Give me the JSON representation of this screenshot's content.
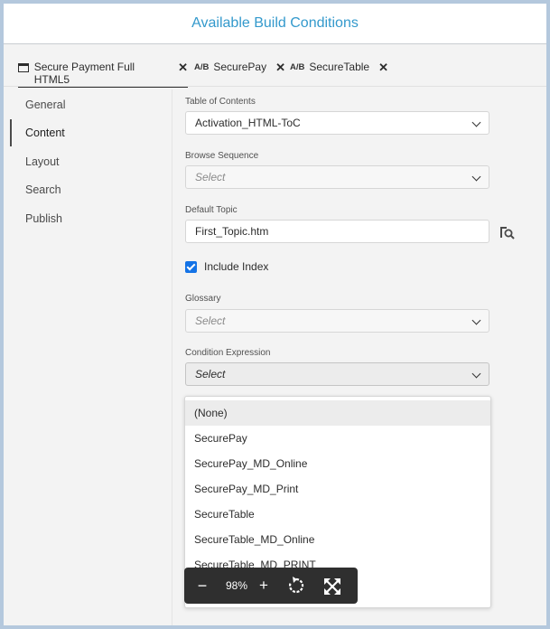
{
  "banner": {
    "title": "Available Build Conditions"
  },
  "tabs": [
    {
      "label": "Secure Payment Full HTML5",
      "prefix": "",
      "close": "✕"
    },
    {
      "label": "SecurePay",
      "prefix": "A/B",
      "close": "✕"
    },
    {
      "label": "SecureTable",
      "prefix": "A/B",
      "close": "✕"
    }
  ],
  "sidebar": {
    "items": [
      {
        "label": "General"
      },
      {
        "label": "Content"
      },
      {
        "label": "Layout"
      },
      {
        "label": "Search"
      },
      {
        "label": "Publish"
      }
    ],
    "active": "Content"
  },
  "form": {
    "toc": {
      "label": "Table of Contents",
      "value": "Activation_HTML-ToC"
    },
    "browse": {
      "label": "Browse Sequence",
      "placeholder": "Select"
    },
    "default_topic": {
      "label": "Default Topic",
      "value": "First_Topic.htm"
    },
    "include_index": {
      "label": "Include Index",
      "checked": true
    },
    "glossary": {
      "label": "Glossary",
      "placeholder": "Select"
    },
    "condition": {
      "label": "Condition Expression",
      "placeholder": "Select"
    }
  },
  "dropdown": {
    "options": [
      "(None)",
      "SecurePay",
      "SecurePay_MD_Online",
      "SecurePay_MD_Print",
      "SecureTable",
      "SecureTable_MD_Online",
      "SecureTable_MD_PRINT"
    ],
    "highlighted": "(None)"
  },
  "zoom": {
    "minus": "−",
    "level": "98%",
    "plus": "+"
  },
  "colors": {
    "accent": "#1473e6",
    "banner_text": "#3399cc",
    "frame": "#b4c8dd"
  }
}
